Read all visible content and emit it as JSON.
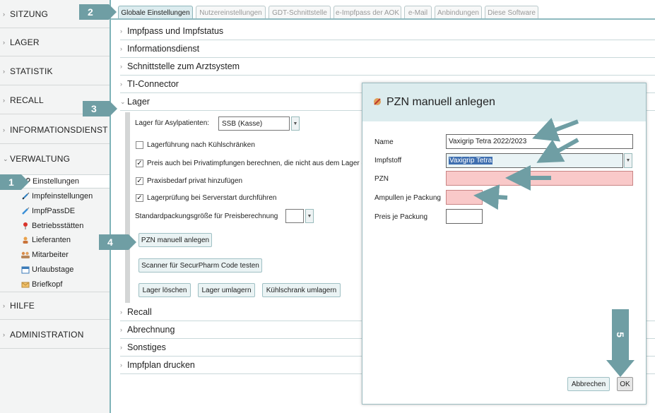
{
  "sidebar": {
    "sections": [
      {
        "label": "SITZUNG",
        "expanded": false
      },
      {
        "label": "LAGER",
        "expanded": false
      },
      {
        "label": "STATISTIK",
        "expanded": false
      },
      {
        "label": "RECALL",
        "expanded": false
      },
      {
        "label": "INFORMATIONSDIENST",
        "expanded": false
      },
      {
        "label": "VERWALTUNG",
        "expanded": true
      },
      {
        "label": "HILFE",
        "expanded": false
      },
      {
        "label": "ADMINISTRATION",
        "expanded": false
      }
    ],
    "verwaltung_items": [
      {
        "label": "Einstellungen",
        "icon": "wrench-icon",
        "active": true
      },
      {
        "label": "Impfeinstellungen",
        "icon": "syringe-icon",
        "active": false
      },
      {
        "label": "ImpfPassDE",
        "icon": "syringe-pen-icon",
        "active": false
      },
      {
        "label": "Betriebsstätten",
        "icon": "map-pin-icon",
        "active": false
      },
      {
        "label": "Lieferanten",
        "icon": "supplier-icon",
        "active": false
      },
      {
        "label": "Mitarbeiter",
        "icon": "users-icon",
        "active": false
      },
      {
        "label": "Urlaubstage",
        "icon": "calendar-icon",
        "active": false
      },
      {
        "label": "Briefkopf",
        "icon": "letter-icon",
        "active": false
      }
    ]
  },
  "tabs": [
    {
      "label": "Globale Einstellungen",
      "active": true
    },
    {
      "label": "Nutzereinstellungen",
      "active": false
    },
    {
      "label": "GDT-Schnittstelle",
      "active": false
    },
    {
      "label": "e-Impfpass der AOK",
      "active": false
    },
    {
      "label": "e-Mail",
      "active": false
    },
    {
      "label": "Anbindungen",
      "active": false
    },
    {
      "label": "Diese Software",
      "active": false
    }
  ],
  "accordion": {
    "impfpass": "Impfpass und Impfstatus",
    "informationsdienst": "Informationsdienst",
    "schnittstelle": "Schnittstelle zum Arztsystem",
    "ti": "TI-Connector",
    "lager": "Lager",
    "recall": "Recall",
    "abrechnung": "Abrechnung",
    "sonstiges": "Sonstiges",
    "impfplan": "Impfplan drucken"
  },
  "lager": {
    "asyl_label": "Lager für Asylpatienten:",
    "asyl_value": "SSB (Kasse)",
    "checkboxes": [
      {
        "label": "Lagerführung nach Kühlschränken",
        "checked": false
      },
      {
        "label": "Preis auch bei Privatimpfungen berechnen, die nicht aus dem Lager e",
        "checked": true
      },
      {
        "label": "Praxisbedarf privat hinzufügen",
        "checked": true
      },
      {
        "label": "Lagerprüfung bei Serverstart durchführen",
        "checked": true
      }
    ],
    "standard_label": "Standardpackungsgröße für Preisberechnung",
    "standard_value": "",
    "buttons": {
      "pzn": "PZN manuell anlegen",
      "scanner": "Scanner für SecurPharm Code testen",
      "loeschen": "Lager löschen",
      "umlagern": "Lager umlagern",
      "kuehlschrank": "Kühlschrank umlagern"
    }
  },
  "dialog": {
    "title": "PZN manuell anlegen",
    "name_label": "Name",
    "name_value": "Vaxigrip Tetra 2022/2023",
    "impfstoff_label": "Impfstoff",
    "impfstoff_value": "Vaxigrip Tetra",
    "pzn_label": "PZN",
    "pzn_value": "",
    "ampullen_label": "Ampullen je Packung",
    "ampullen_value": "",
    "preis_label": "Preis je Packung",
    "preis_value": "",
    "cancel": "Abbrechen",
    "ok": "OK"
  },
  "annotations": {
    "step1": "1",
    "step2": "2",
    "step3": "3",
    "step4": "4",
    "step5": "5",
    "color": "#6f9ea4"
  },
  "colors": {
    "accent": "#8fbac0",
    "tab_active": "#dcecef",
    "error_field": "#f9c9c9",
    "selection": "#3f6fb0"
  }
}
